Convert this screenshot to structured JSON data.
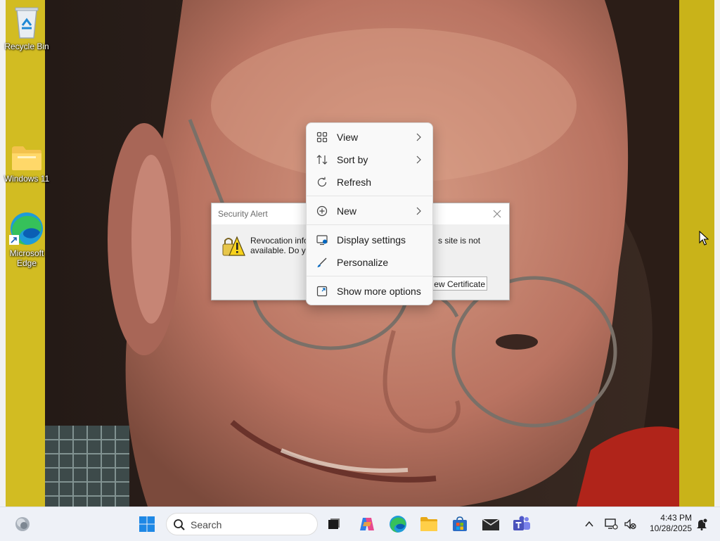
{
  "desktop": {
    "icons": [
      {
        "label": "Recycle Bin",
        "icon": "recycle-bin-icon"
      },
      {
        "label": "Windows 11",
        "icon": "folder-icon"
      },
      {
        "label": "Microsoft Edge",
        "line1": "Microsoft",
        "line2": "Edge",
        "icon": "edge-icon"
      }
    ]
  },
  "security_alert": {
    "title": "Security Alert",
    "message_left_line1": "Revocation infor",
    "message_left_line2": "available. Do you",
    "message_right_line1": "s site is not",
    "view_certificate": "ew Certificate"
  },
  "context_menu": {
    "items": [
      {
        "label": "View",
        "icon": "view-grid-icon",
        "submenu": true
      },
      {
        "label": "Sort by",
        "icon": "sort-icon",
        "submenu": true
      },
      {
        "label": "Refresh",
        "icon": "refresh-icon",
        "submenu": false
      },
      {
        "label": "New",
        "icon": "new-plus-icon",
        "submenu": true
      },
      {
        "label": "Display settings",
        "icon": "display-settings-icon",
        "submenu": false
      },
      {
        "label": "Personalize",
        "icon": "personalize-brush-icon",
        "submenu": false
      },
      {
        "label": "Show more options",
        "icon": "show-more-options-icon",
        "submenu": false
      }
    ]
  },
  "taskbar": {
    "search_placeholder": "Search",
    "time": "4:43 PM",
    "date": "10/28/2025",
    "apps": [
      "widgets-icon",
      "start-icon",
      "task-view-icon",
      "copilot-icon",
      "edge-icon",
      "file-explorer-icon",
      "store-icon",
      "mail-icon",
      "teams-icon"
    ],
    "tray": [
      "chevron-up-icon",
      "network-icon",
      "volume-muted-icon",
      "notification-icon"
    ]
  },
  "colors": {
    "wallpaper_frame": "#c9b319",
    "menu_bg": "#f9f9f9",
    "accent": "#0067c0"
  }
}
